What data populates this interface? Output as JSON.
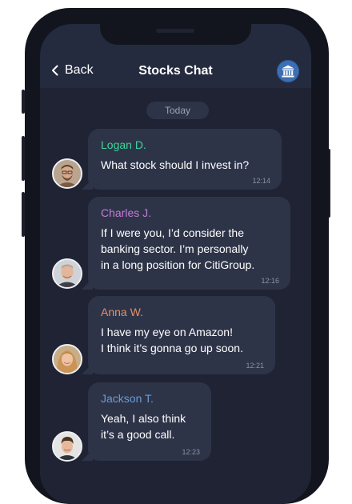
{
  "header": {
    "back_label": "Back",
    "title": "Stocks Chat"
  },
  "chat": {
    "date_label": "Today",
    "messages": [
      {
        "sender": "Logan D.",
        "name_color": "#3fd39a",
        "lines": [
          "What stock should I invest in?"
        ],
        "time": "12:14"
      },
      {
        "sender": "Charles J.",
        "name_color": "#c27ad6",
        "lines": [
          "If I were you, I’d consider the",
          "banking sector. I’m personally",
          "in a long position for CitiGroup."
        ],
        "time": "12:16"
      },
      {
        "sender": "Anna W.",
        "name_color": "#e3906a",
        "lines": [
          "I have my eye on Amazon!",
          "I think it’s gonna go up soon."
        ],
        "time": "12:21"
      },
      {
        "sender": "Jackson T.",
        "name_color": "#6b9bd4",
        "lines": [
          "Yeah, I also think",
          "it’s a good call."
        ],
        "time": "12:23"
      }
    ]
  },
  "icons": {
    "back": "chevron-left-icon",
    "bank": "bank-icon"
  },
  "colors": {
    "header_bg": "#252b3e",
    "chat_bg": "#1f2333",
    "bubble_bg": "#2e3448",
    "accent_bank": "#3c6fb3"
  }
}
